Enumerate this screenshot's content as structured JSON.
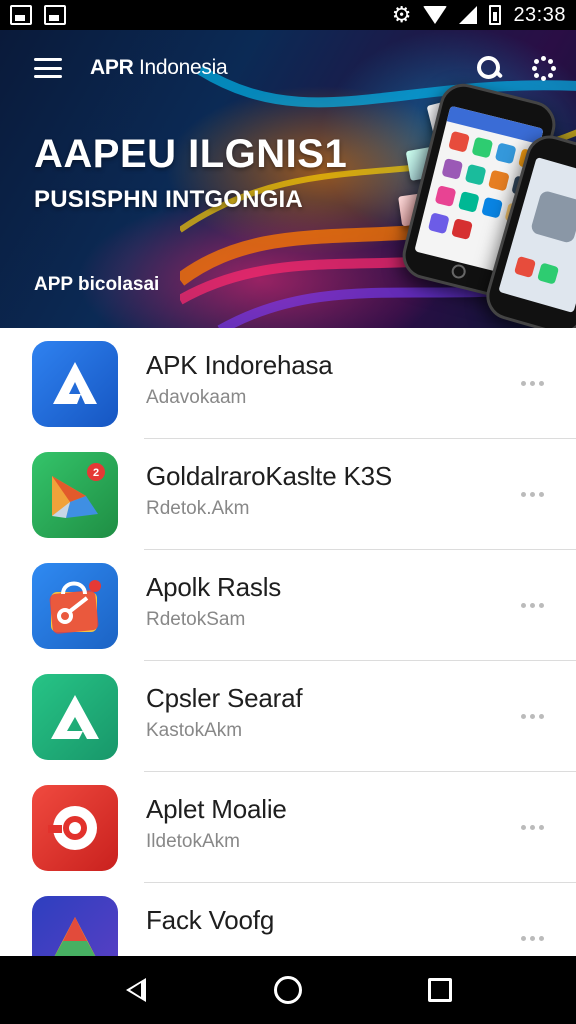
{
  "status_bar": {
    "time": "23:38",
    "left_icons": [
      "image-icon",
      "photo-icon"
    ],
    "right_icons": [
      "settings-icon",
      "wifi-icon",
      "signal-icon",
      "battery-icon"
    ]
  },
  "header": {
    "app_title_bold": "APR",
    "app_title_rest": " Indonesia",
    "search_label": "search-icon",
    "loading_label": "loading-icon"
  },
  "hero": {
    "title": "AAPEU ILGNIS1",
    "subtitle": "PUSISPHN INTGONGIA",
    "caption": "APP bicolasai"
  },
  "apps": [
    {
      "name": "APK Indorehasa",
      "subtitle": "Adavokaam",
      "icon": "arrow-a-icon",
      "colors": [
        "#1f6fe0",
        "#1656c2"
      ]
    },
    {
      "name": "GoldalraroKaslte  K3S",
      "subtitle": "Rdetok.Akm",
      "icon": "folded-arrow-icon",
      "colors": [
        "#2bb15a",
        "#1f8e44"
      ]
    },
    {
      "name": "Apolk Rasls",
      "subtitle": "RdetokSam",
      "icon": "shopping-bag-icon",
      "colors": [
        "#1f7ae6",
        "#1c63c4"
      ]
    },
    {
      "name": "Cpsler Searaf",
      "subtitle": "KastokAkm",
      "icon": "arrow-a-icon",
      "colors": [
        "#20b67a",
        "#18976a"
      ]
    },
    {
      "name": "Aplet Moalie",
      "subtitle": "IldetokAkm",
      "icon": "record-icon",
      "colors": [
        "#ea3430",
        "#c9211e"
      ]
    },
    {
      "name": "Fack Voofg",
      "subtitle": "",
      "icon": "triangle-icon",
      "colors": [
        "#3046c4",
        "#e24b3b"
      ]
    }
  ],
  "nav_bar": {
    "buttons": [
      "back-button",
      "home-button",
      "recents-button"
    ]
  }
}
